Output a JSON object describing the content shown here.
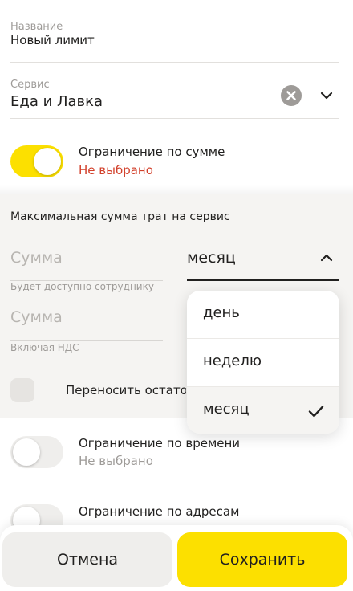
{
  "name_field": {
    "label": "Название",
    "value": "Новый лимит"
  },
  "service_field": {
    "label": "Сервис",
    "value": "Еда и Лавка"
  },
  "amount_limit": {
    "title": "Ограничение по сумме",
    "status": "Не выбрано",
    "enabled": true
  },
  "max_amount": {
    "heading": "Максимальная сумма трат на сервис",
    "sum_placeholder": "Сумма",
    "sum_hint": "Будет доступно сотруднику",
    "sum2_placeholder": "Сумма",
    "sum2_hint": "Включая НДС",
    "period_value": "месяц",
    "carry_over_label": "Переносить остаток"
  },
  "period_dropdown": {
    "options": [
      "день",
      "неделю",
      "месяц"
    ],
    "selected": "месяц"
  },
  "time_limit": {
    "title": "Ограничение по времени",
    "status": "Не выбрано",
    "enabled": false
  },
  "address_limit": {
    "title": "Ограничение по адресам",
    "enabled": false
  },
  "actions": {
    "cancel_label": "Отмена",
    "save_label": "Сохранить"
  },
  "colors": {
    "accent": "#fce000",
    "warning_text": "#d2402b",
    "muted_text": "#9e9b98"
  }
}
